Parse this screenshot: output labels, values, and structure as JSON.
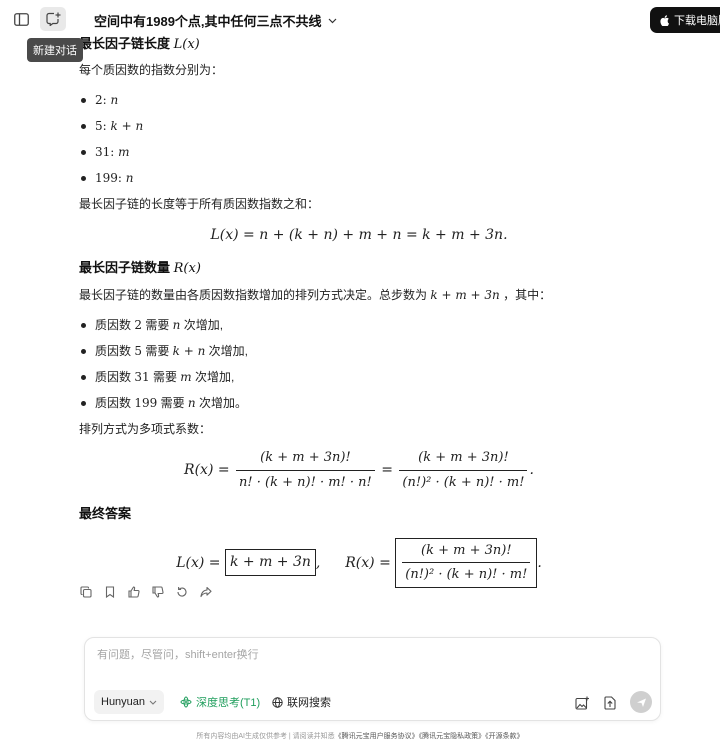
{
  "header": {
    "title": "空间中有1989个点,其中任何三点不共线",
    "download_label": "下载电脑版",
    "tooltip": "新建对话"
  },
  "content": {
    "section1_heading": "最长因子链长度",
    "section1_heading_math": "L(x)",
    "exponents_intro": "每个质因数的指数分别为：",
    "exponents": [
      {
        "base": "2",
        "exp": "n"
      },
      {
        "base": "5",
        "exp": "k + n"
      },
      {
        "base": "31",
        "exp": "m"
      },
      {
        "base": "199",
        "exp": "n"
      }
    ],
    "length_intro": "最长因子链的长度等于所有质因数指数之和：",
    "length_formula": "L(x) = n + (k + n) + m + n = k + m + 3n.",
    "section2_heading": "最长因子链数量",
    "section2_heading_math": "R(x)",
    "count_intro_prefix": "最长因子链的数量由各质因数指数增加的排列方式决定。总步数为",
    "count_intro_math": "k + m + 3n",
    "count_intro_suffix": "，其中：",
    "steps": [
      {
        "pre": "质因数 ",
        "prime": "2",
        "mid": " 需要 ",
        "count": "n",
        "post": " 次增加,"
      },
      {
        "pre": "质因数 ",
        "prime": "5",
        "mid": " 需要 ",
        "count": "k + n",
        "post": " 次增加,"
      },
      {
        "pre": "质因数 ",
        "prime": "31",
        "mid": " 需要 ",
        "count": "m",
        "post": " 次增加,"
      },
      {
        "pre": "质因数 ",
        "prime": "199",
        "mid": " 需要 ",
        "count": "n",
        "post": " 次增加。"
      }
    ],
    "multinomial_intro": "排列方式为多项式系数：",
    "r_lhs": "R(x) =",
    "r_frac1_num": "(k + m + 3n)!",
    "r_frac1_den": "n! · (k + n)! · m! · n!",
    "r_eq": "=",
    "r_frac2_num": "(k + m + 3n)!",
    "r_frac2_den": "(n!)² · (k + n)! · m!",
    "r_end": ".",
    "final_heading": "最终答案",
    "final_l_lhs": "L(x) =",
    "final_l_box": "k + m + 3n",
    "final_sep": ",",
    "final_r_lhs": "R(x) =",
    "final_r_num": "(k + m + 3n)!",
    "final_r_den": "(n!)² · (k + n)! · m!",
    "final_end": "."
  },
  "composer": {
    "placeholder": "有问题，尽管问，shift+enter换行",
    "model_label": "Hunyuan",
    "think_label": "深度思考(T1)",
    "search_label": "联网搜索"
  },
  "footer": {
    "disclaimer": "所有内容均由AI生成仅供参考",
    "sep": " | ",
    "read_agree": "请阅读并知悉",
    "link1": "《腾讯元宝用户服务协议》",
    "link2": "《腾讯元宝隐私政策》",
    "link3": "《开源条款》"
  },
  "colors": {
    "accent_green": "#1f9e5c",
    "download_bg": "#111111",
    "send_disabled": "#cfcfcf"
  },
  "icons": [
    "sidebar-toggle-icon",
    "new-chat-icon",
    "chevron-down-icon",
    "apple-icon",
    "copy-icon",
    "bookmark-icon",
    "thumbs-up-icon",
    "thumbs-down-icon",
    "regenerate-icon",
    "share-icon",
    "chevron-down-icon",
    "atom-icon",
    "globe-icon",
    "image-upload-icon",
    "file-upload-icon",
    "send-icon"
  ]
}
